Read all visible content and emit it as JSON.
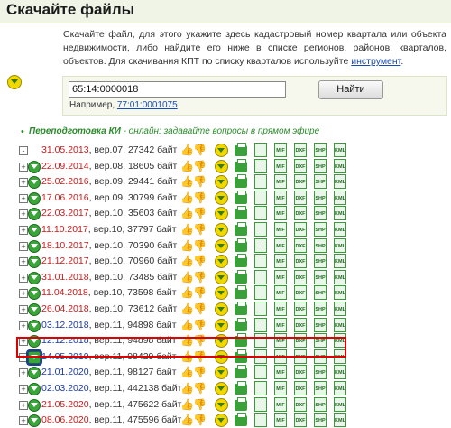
{
  "header": {
    "title": "Скачайте файлы"
  },
  "intro": {
    "text": "Скачайте файл, для этого укажите здесь кадастровый номер квартала или объекта недвижимости, либо найдите его ниже в списке регионов, районов, кварталов, объектов. Для скачивания КПТ по списку кварталов используйте",
    "link": "инструмент",
    "end": "."
  },
  "search": {
    "value": "65:14:0000018",
    "button": "Найти",
    "hint_prefix": "Например,",
    "hint_link": "77:01:0001075"
  },
  "announce": {
    "bold": "Переподготовка КИ",
    "rest": " - онлайн: задавайте вопросы в прямом эфире"
  },
  "doc_icons": [
    "MIF",
    "DXF",
    "SHP",
    "KML"
  ],
  "rows": [
    {
      "pm": "-",
      "date": "31.05.2013",
      "info": ", вер.07, 27342 байт"
    },
    {
      "pm": "+",
      "date": "22.09.2014",
      "info": ", вер.08, 18605 байт"
    },
    {
      "pm": "+",
      "date": "25.02.2016",
      "info": ", вер.09, 29441 байт"
    },
    {
      "pm": "+",
      "date": "17.06.2016",
      "info": ", вер.09, 30799 байт"
    },
    {
      "pm": "+",
      "date": "22.03.2017",
      "info": ", вер.10, 35603 байт"
    },
    {
      "pm": "+",
      "date": "11.10.2017",
      "info": ", вер.10, 37797 байт"
    },
    {
      "pm": "+",
      "date": "18.10.2017",
      "info": ", вер.10, 70390 байт"
    },
    {
      "pm": "+",
      "date": "21.12.2017",
      "info": ", вер.10, 70960 байт"
    },
    {
      "pm": "+",
      "date": "31.01.2018",
      "info": ", вер.10, 73485 байт"
    },
    {
      "pm": "+",
      "date": "11.04.2018",
      "info": ", вер.10, 73598 байт"
    },
    {
      "pm": "+",
      "date": "26.04.2018",
      "info": ", вер.10, 73612 байт"
    },
    {
      "pm": "+",
      "date": "03.12.2018",
      "info": ", вер.11, 94898 байт"
    },
    {
      "pm": "+",
      "date": "12.12.2018",
      "info": ", вер.11, 94898 байт"
    },
    {
      "pm": "+",
      "date": "14.05.2019",
      "info": ", вер.11, 98429 байт",
      "highlight": true
    },
    {
      "pm": "+",
      "date": "21.01.2020",
      "info": ", вер.11, 98127 байт"
    },
    {
      "pm": "+",
      "date": "02.03.2020",
      "info": ", вер.11, 442138 байт"
    },
    {
      "pm": "+",
      "date": "21.05.2020",
      "info": ", вер.11, 475622 байт"
    },
    {
      "pm": "+",
      "date": "08.06.2020",
      "info": ", вер.11, 475596 байт"
    }
  ]
}
